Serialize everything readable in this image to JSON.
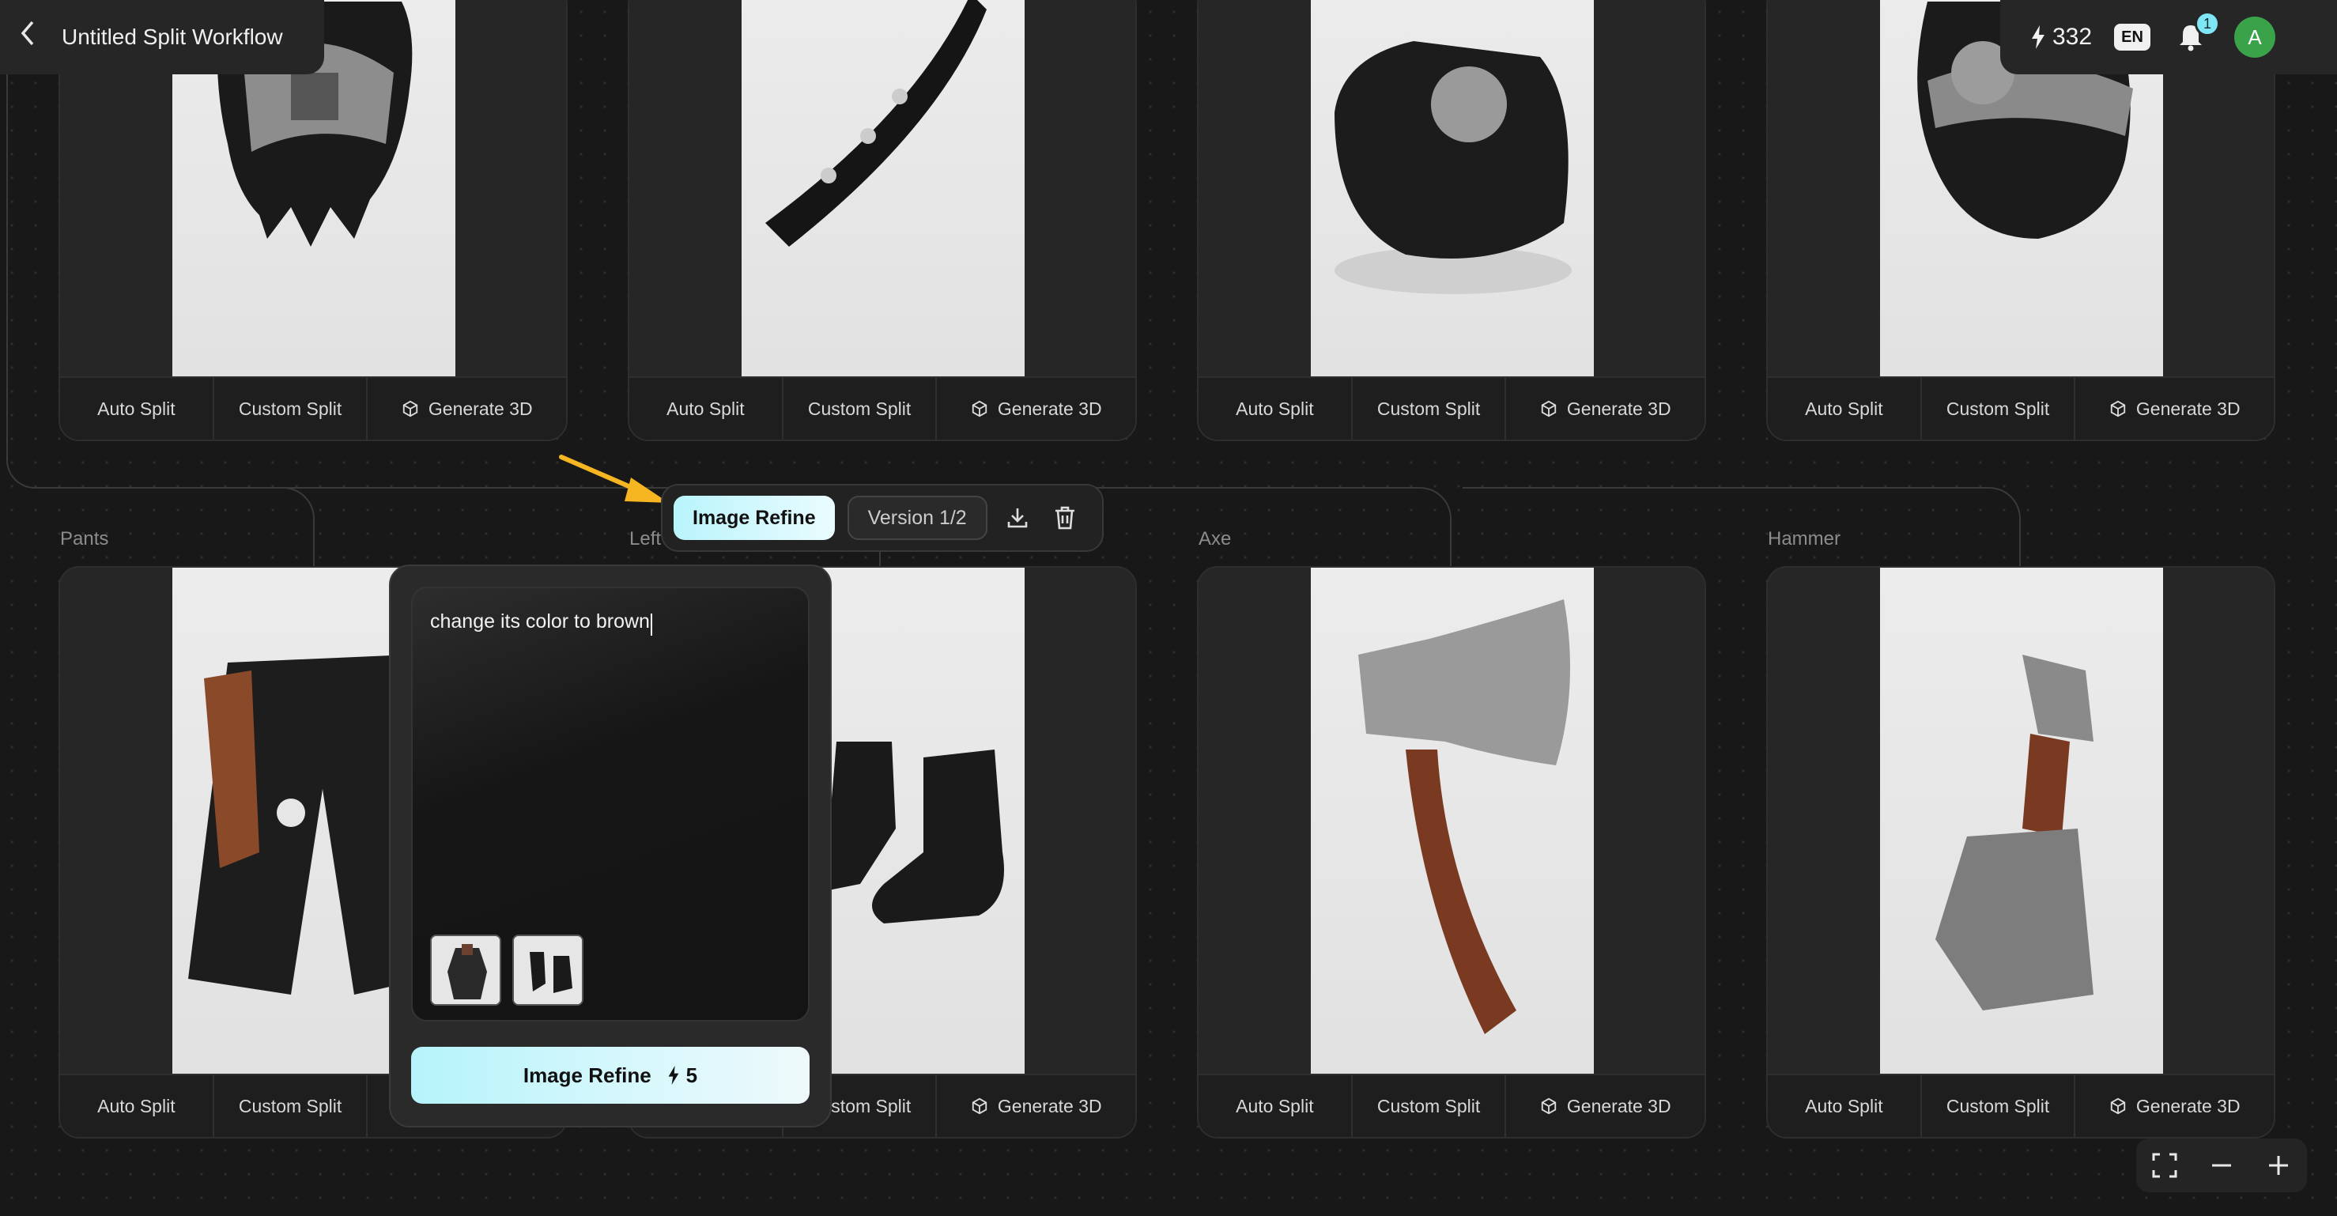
{
  "header": {
    "back_label": "<",
    "title": "Untitled Split Workflow",
    "credits": "332",
    "language": "EN",
    "notification_count": "1",
    "avatar_initial": "A"
  },
  "card_actions": {
    "auto_split": "Auto Split",
    "custom_split": "Custom Split",
    "generate_3d": "Generate 3D"
  },
  "bottom_row_labels": {
    "pants": "Pants",
    "left": "Left",
    "axe": "Axe",
    "hammer": "Hammer"
  },
  "toolbar": {
    "image_refine": "Image Refine",
    "version": "Version 1/2"
  },
  "refine_popover": {
    "prompt": "change its color to brown",
    "button_label": "Image Refine",
    "cost": "5"
  },
  "colors": {
    "accent": "#b9f4fb",
    "background": "#181818",
    "arrow": "#f5b622"
  },
  "icons": [
    "bolt-icon",
    "bell-icon",
    "download-icon",
    "trash-icon",
    "cube-icon",
    "fullscreen-icon",
    "minus-icon",
    "plus-icon"
  ]
}
